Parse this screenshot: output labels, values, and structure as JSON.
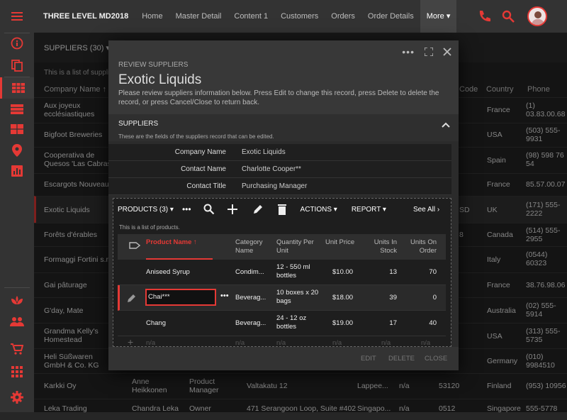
{
  "app": {
    "title": "THREE LEVEL MD2018",
    "nav": [
      "Home",
      "Master Detail",
      "Content 1",
      "Customers",
      "Orders",
      "Order Details",
      "More"
    ]
  },
  "icons": {
    "menu": "menu-icon",
    "phone": "phone-icon",
    "search": "search-icon",
    "avatar": "user-avatar"
  },
  "colors": {
    "accent": "#e53935",
    "surface": "#262626",
    "modal": "#2b2b2b"
  },
  "suppliers": {
    "title": "SUPPLIERS (30)",
    "info": "This is a list of suppliers.",
    "columns": [
      "Company Name",
      "Code",
      "Country",
      "Phone"
    ],
    "rows": [
      {
        "company": "Aux joyeux ecclésiastiques",
        "country": "France",
        "phone": "(1) 03.83.00.68"
      },
      {
        "company": "Bigfoot Breweries",
        "country": "USA",
        "phone": "(503) 555-9931"
      },
      {
        "company": "Cooperativa de Quesos 'Las Cabras'",
        "country": "Spain",
        "phone": "(98) 598 76 54"
      },
      {
        "company": "Escargots Nouveaux",
        "country": "France",
        "phone": "85.57.00.07"
      },
      {
        "company": "Exotic Liquids",
        "code": "SD",
        "country": "UK",
        "phone": "(171) 555-2222"
      },
      {
        "company": "Forêts d'érables",
        "code": "8",
        "country": "Canada",
        "phone": "(514) 555-2955"
      },
      {
        "company": "Formaggi Fortini s.r.l.",
        "country": "Italy",
        "phone": "(0544) 60323"
      },
      {
        "company": "Gai pâturage",
        "country": "France",
        "phone": "38.76.98.06"
      },
      {
        "company": "G'day, Mate",
        "country": "Australia",
        "phone": "(02) 555-5914"
      },
      {
        "company": "Grandma Kelly's Homestead",
        "country": "USA",
        "phone": "(313) 555-5735"
      },
      {
        "company": "Heli Süßwaren GmbH & Co. KG",
        "country": "Germany",
        "phone": "(010) 9984510"
      },
      {
        "company": "Karkki Oy",
        "contact": "Anne Heikkonen",
        "title": "Product Manager",
        "address": "Valtakatu 12",
        "city": "Lappee...",
        "region": "n/a",
        "postal": "53120",
        "country": "Finland",
        "phone": "(953) 10956"
      },
      {
        "company": "Leka Trading",
        "contact": "Chandra Leka",
        "title": "Owner",
        "address": "471 Serangoon Loop, Suite #402",
        "city": "Singapo...",
        "region": "n/a",
        "postal": "0512",
        "country": "Singapore",
        "phone": "555-5778"
      }
    ]
  },
  "modal": {
    "kicker": "REVIEW SUPPLIERS",
    "title": "Exotic Liquids",
    "description": "Please review suppliers information below. Press Edit to change this record, press Delete to delete the record, or press Cancel/Close to return back.",
    "section": "SUPPLIERS",
    "section_desc": "These are the fields of the suppliers record that can be edited.",
    "fields": [
      {
        "label": "Company Name",
        "value": "Exotic Liquids"
      },
      {
        "label": "Contact Name",
        "value": "Charlotte Cooper**"
      },
      {
        "label": "Contact Title",
        "value": "Purchasing Manager"
      }
    ],
    "footer": {
      "edit": "EDIT",
      "delete": "DELETE",
      "close": "CLOSE"
    }
  },
  "products": {
    "title": "PRODUCTS (3)",
    "actions": "ACTIONS",
    "report": "REPORT",
    "see_all": "See All",
    "info": "This is a list of products.",
    "columns": {
      "name": "Product Name",
      "category": "Category Name",
      "qty": "Quantity Per Unit",
      "price": "Unit Price",
      "stock": "Units In Stock",
      "order": "Units On Order"
    },
    "rows": [
      {
        "name": "Aniseed Syrup",
        "category": "Condim...",
        "qty": "12 - 550 ml bottles",
        "price": "$10.00",
        "stock": "13",
        "order": "70"
      },
      {
        "name": "Chai***",
        "category": "Beverag...",
        "qty": "10 boxes x 20 bags",
        "price": "$18.00",
        "stock": "39",
        "order": "0"
      },
      {
        "name": "Chang",
        "category": "Beverag...",
        "qty": "24 - 12 oz bottles",
        "price": "$19.00",
        "stock": "17",
        "order": "40"
      }
    ],
    "new_row": "n/a"
  }
}
